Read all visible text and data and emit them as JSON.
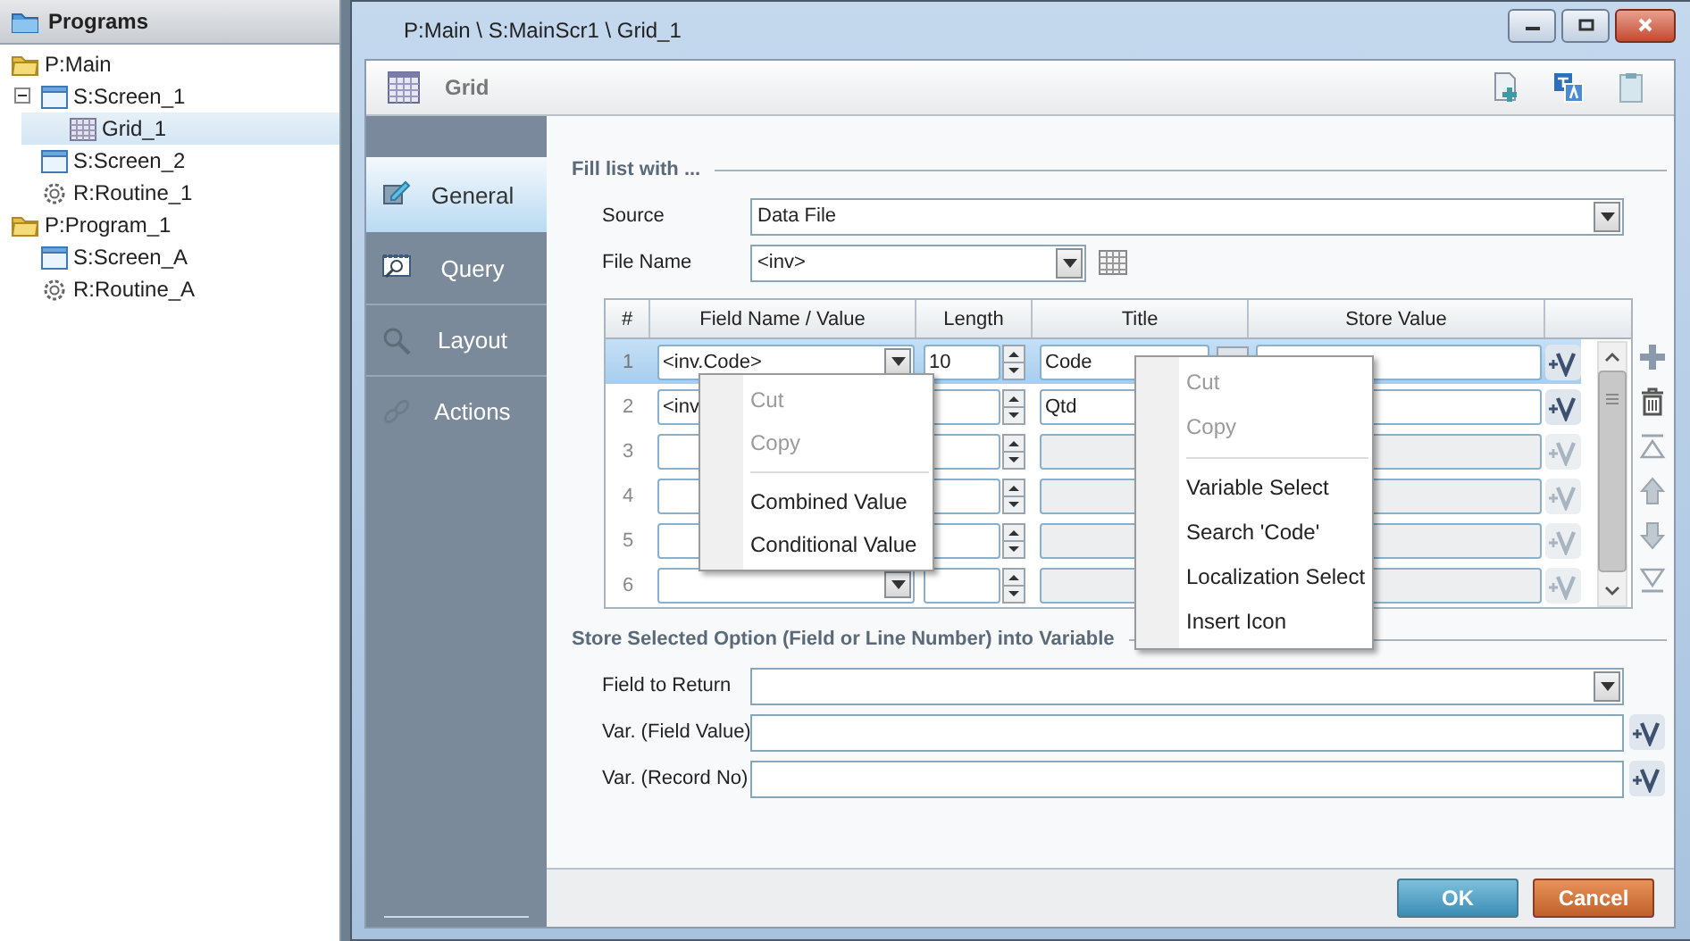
{
  "sidebar": {
    "title": "Programs",
    "tree": [
      {
        "label": "P:Main",
        "kind": "program",
        "selected": false,
        "children": [
          {
            "label": "S:Screen_1",
            "kind": "screen",
            "selected": false,
            "expanded": true,
            "children": [
              {
                "label": "Grid_1",
                "kind": "grid",
                "selected": true
              }
            ]
          },
          {
            "label": "S:Screen_2",
            "kind": "screen",
            "selected": false
          },
          {
            "label": "R:Routine_1",
            "kind": "routine",
            "selected": false
          }
        ]
      },
      {
        "label": "P:Program_1",
        "kind": "program",
        "selected": false,
        "children": [
          {
            "label": "S:Screen_A",
            "kind": "screen",
            "selected": false
          },
          {
            "label": "R:Routine_A",
            "kind": "routine",
            "selected": false
          }
        ]
      }
    ]
  },
  "window": {
    "title": "P:Main \\ S:MainScr1 \\ Grid_1",
    "header": "Grid"
  },
  "nav": [
    {
      "label": "General",
      "kind": "general",
      "selected": true
    },
    {
      "label": "Query",
      "kind": "query",
      "selected": false
    },
    {
      "label": "Layout",
      "kind": "layout",
      "selected": false
    },
    {
      "label": "Actions",
      "kind": "actions",
      "selected": false
    }
  ],
  "fill_section": {
    "title": "Fill list with ...",
    "source_label": "Source",
    "source": "Data File",
    "file_label": "File Name",
    "file": "<inv>"
  },
  "grid": {
    "columns": [
      "#",
      "Field Name / Value",
      "Length",
      "Title",
      "Store Value"
    ],
    "rows": [
      {
        "number": "1",
        "field": "<inv.Code>",
        "dropdown": true,
        "length": "10",
        "title": "Code",
        "selected": true,
        "disabled": false
      },
      {
        "number": "2",
        "field": "<inv",
        "title": "Qtd",
        "selected": false,
        "disabled": false
      },
      {
        "number": "3",
        "selected": false,
        "disabled": true
      },
      {
        "number": "4",
        "selected": false,
        "disabled": true
      },
      {
        "number": "5",
        "selected": false,
        "disabled": true
      },
      {
        "number": "6",
        "dropdown": true,
        "selected": false,
        "disabled": true
      }
    ]
  },
  "store_section": {
    "title": "Store Selected Option (Field or Line Number) into Variable",
    "field_to_return_label": "Field to Return",
    "var_field_label": "Var. (Field Value)",
    "var_record_label": "Var. (Record No)"
  },
  "buttons": [
    {
      "label": "OK",
      "kind": "primary"
    },
    {
      "label": "Cancel",
      "kind": "cancel"
    }
  ],
  "context_menus": [
    {
      "items": [
        {
          "kind": "item",
          "label": "Cut",
          "disabled": true
        },
        {
          "kind": "item",
          "label": "Copy",
          "disabled": true
        },
        {
          "kind": "separator"
        },
        {
          "kind": "item",
          "label": "Combined Value",
          "disabled": false
        },
        {
          "kind": "item",
          "label": "Conditional Value",
          "disabled": false
        }
      ]
    },
    {
      "items": [
        {
          "kind": "item",
          "label": "Cut",
          "disabled": true
        },
        {
          "kind": "item",
          "label": "Copy",
          "disabled": true
        },
        {
          "kind": "separator"
        },
        {
          "kind": "item",
          "label": "Variable Select",
          "disabled": false
        },
        {
          "kind": "item",
          "label": "Search 'Code'",
          "disabled": false
        },
        {
          "kind": "item",
          "label": "Localization Select",
          "disabled": false
        },
        {
          "kind": "item",
          "label": "Insert Icon",
          "disabled": false
        }
      ]
    }
  ]
}
